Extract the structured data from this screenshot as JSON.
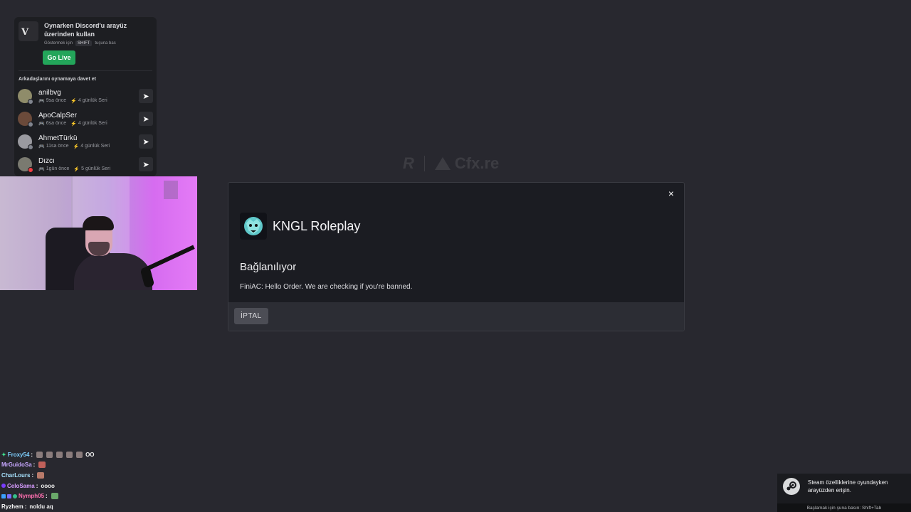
{
  "background": {
    "brand_rockstar": "R",
    "brand_cfx": "Cfx.re"
  },
  "discord": {
    "title": "Oynarken Discord'u arayüz üzerinden kullan",
    "hint_prefix": "Göstermek için",
    "hint_key": "SHIFT",
    "hint_suffix": "tuşuna bas",
    "go_live": "Go Live",
    "invite_label": "Arkadaşlarını oynamaya davet et",
    "friends": [
      {
        "name": "anilbvg",
        "last": "9sa önce",
        "streak": "4 günlük Seri"
      },
      {
        "name": "ApoCalpSer",
        "last": "6sa önce",
        "streak": "4 günlük Seri"
      },
      {
        "name": "AhmetTürkü",
        "last": "11sa önce",
        "streak": "4 günlük Seri"
      },
      {
        "name": "Dızcı",
        "last": "1gün önce",
        "streak": "5 günlük Seri"
      }
    ]
  },
  "modal": {
    "server_name": "KNGL Roleplay",
    "status": "Bağlanılıyor",
    "message": "FiniAC: Hello Order. We are checking if you're banned.",
    "cancel": "İPTAL",
    "close": "×"
  },
  "chat": [
    {
      "user": "Froxy54",
      "color": "#7fd0ff",
      "text": "OO"
    },
    {
      "user": "MrGuidoSa",
      "color": "#c7a7ff",
      "text": ""
    },
    {
      "user": "CharLours",
      "color": "#a8e3ff",
      "text": ""
    },
    {
      "user": "CeloSama",
      "color": "#d79cff",
      "text": "oooo"
    },
    {
      "user": "Nymph05",
      "color": "#ff6fb0",
      "text": ""
    },
    {
      "user": "Ryzhem",
      "color": "#ffffff",
      "text": "noldu aq"
    }
  ],
  "steam": {
    "text": "Steam özelliklerine oyundayken arayüzden erişin.",
    "shortcut": "Başlamak için şuna basın: Shift+Tab"
  }
}
